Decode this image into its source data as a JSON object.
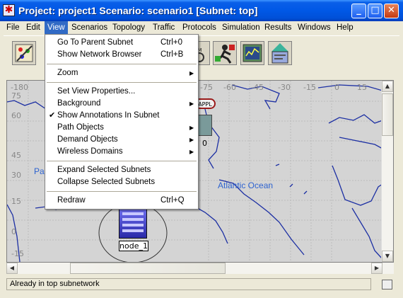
{
  "window": {
    "title": "Project: project1 Scenario: scenario1  [Subnet: top]"
  },
  "menubar": {
    "items": [
      {
        "label": "File"
      },
      {
        "label": "Edit"
      },
      {
        "label": "View"
      },
      {
        "label": "Scenarios"
      },
      {
        "label": "Topology"
      },
      {
        "label": "Traffic"
      },
      {
        "label": "Protocols"
      },
      {
        "label": "Simulation"
      },
      {
        "label": "Results"
      },
      {
        "label": "Windows"
      },
      {
        "label": "Help"
      }
    ],
    "active": "View"
  },
  "view_menu": {
    "items": [
      {
        "label": "Go To Parent Subnet",
        "shortcut": "Ctrl+0"
      },
      {
        "label": "Show Network Browser",
        "shortcut": "Ctrl+B"
      },
      {
        "label": "Zoom"
      },
      {
        "label": "Set View Properties..."
      },
      {
        "label": "Background"
      },
      {
        "label": "Show Annotations In Subnet",
        "checked": true
      },
      {
        "label": "Path Objects"
      },
      {
        "label": "Demand Objects"
      },
      {
        "label": "Wireless Domains"
      },
      {
        "label": "Expand Selected Subnets"
      },
      {
        "label": "Collapse Selected Subnets"
      },
      {
        "label": "Redraw",
        "shortcut": "Ctrl+Q"
      }
    ]
  },
  "map": {
    "longitudes": [
      "-180",
      "-75",
      "-60",
      "-45",
      "-30",
      "-15",
      "0",
      "15"
    ],
    "latitudes": [
      "75",
      "60",
      "45",
      "30",
      "15",
      "0",
      "-15"
    ],
    "ocean_label": "Atlantic Ocean",
    "pacific_fragment": "Pa",
    "appl_label": "APPL",
    "node_label": "node_1",
    "icon_text": "0"
  },
  "status": {
    "text": "Already in top subnetwork"
  },
  "colors": {
    "title_blue": "#0058e6",
    "menu_highlight": "#316ac5",
    "coastline": "#1c2fa3",
    "ocean_label": "#2e63d0"
  }
}
